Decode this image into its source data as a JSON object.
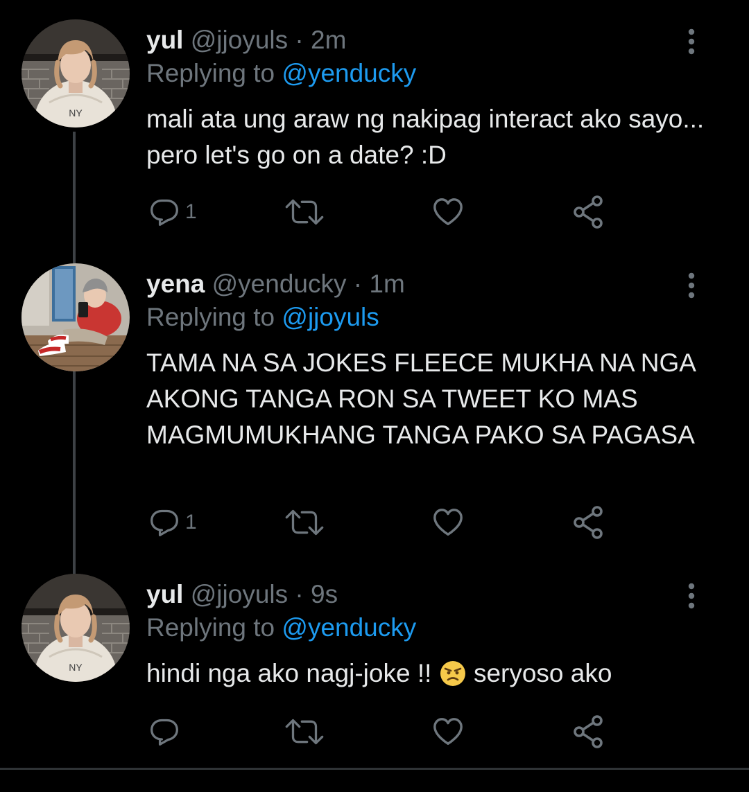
{
  "colors": {
    "background": "#000000",
    "text": "#e7e9ea",
    "muted": "#6e767d",
    "link": "#1d9bf0",
    "thread_line": "#3d4145"
  },
  "tweets": [
    {
      "name": "yul",
      "handle": "@jjoyuls",
      "separator": "·",
      "time": "2m",
      "reply_prefix": "Replying to",
      "reply_target": "@yenducky",
      "text": "mali ata ung araw ng nakipag interact ako sayo... pero let's go on a date? :D",
      "reply_count": "1",
      "avatar": "avatar-yul",
      "icons": [
        "reply-icon",
        "retweet-icon",
        "like-icon",
        "share-icon",
        "more-icon"
      ]
    },
    {
      "name": "yena",
      "handle": "@yenducky",
      "separator": "·",
      "time": "1m",
      "reply_prefix": "Replying to",
      "reply_target": "@jjoyuls",
      "text": "TAMA NA SA JOKES FLEECE MUKHA NA NGA AKONG TANGA RON SA TWEET KO MAS MAGMUMUKHANG TANGA PAKO SA PAGASA",
      "reply_count": "1",
      "avatar": "avatar-yena",
      "icons": [
        "reply-icon",
        "retweet-icon",
        "like-icon",
        "share-icon",
        "more-icon"
      ]
    },
    {
      "name": "yul",
      "handle": "@jjoyuls",
      "separator": "·",
      "time": "9s",
      "reply_prefix": "Replying to",
      "reply_target": "@yenducky",
      "text_before_emoji": "hindi nga ako nagj-joke !! ",
      "emoji": "angry-face-emoji",
      "text_after_emoji": " seryoso ako",
      "reply_count": "",
      "avatar": "avatar-yul",
      "icons": [
        "reply-icon",
        "retweet-icon",
        "like-icon",
        "share-icon",
        "more-icon"
      ]
    }
  ]
}
